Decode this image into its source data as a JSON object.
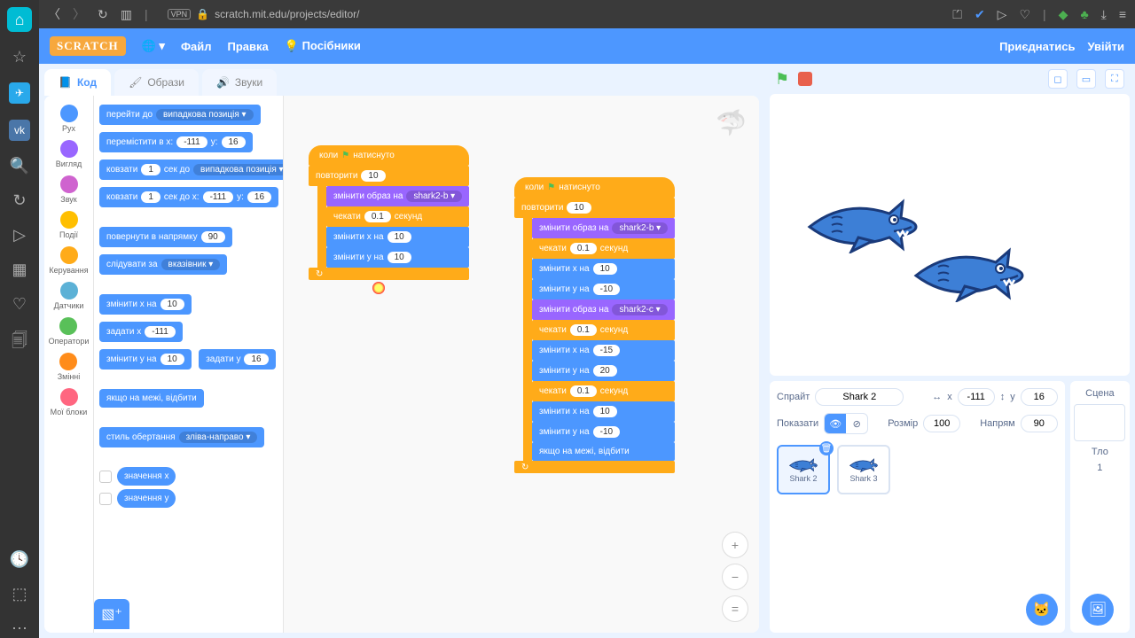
{
  "browser": {
    "url": "scratch.mit.edu/projects/editor/",
    "vpn_badge": "VPN"
  },
  "menu": {
    "file": "Файл",
    "edit": "Правка",
    "tutorials": "Посібники",
    "join": "Приєднатись",
    "signin": "Увійти"
  },
  "tabs": {
    "code": "Код",
    "costumes": "Образи",
    "sounds": "Звуки"
  },
  "categories": {
    "motion": "Рух",
    "looks": "Вигляд",
    "sound": "Звук",
    "events": "Події",
    "control": "Керування",
    "sensing": "Датчики",
    "operators": "Оператори",
    "variables": "Змінні",
    "myblocks": "Мої блоки"
  },
  "cat_colors": {
    "motion": "#4c97ff",
    "looks": "#9966ff",
    "sound": "#cf63cf",
    "events": "#ffbf00",
    "control": "#ffab19",
    "sensing": "#5cb1d6",
    "operators": "#59c059",
    "variables": "#ff8c1a",
    "myblocks": "#ff6680"
  },
  "palette": {
    "goto_label": "перейти до",
    "goto_opt": "випадкова позиція ▾",
    "moveto_xy": "перемістити в x:",
    "moveto_x": "-111",
    "moveto_yl": "y:",
    "moveto_y": "16",
    "glide_rand": "ковзати",
    "glide_rand_sec": "1",
    "glide_rand_to": "сек до",
    "glide_rand_opt": "випадкова позиція ▾",
    "glide_xy": "ковзати",
    "glide_xy_sec": "1",
    "glide_xy_to": "сек до x:",
    "glide_xy_x": "-111",
    "glide_xy_yl": "y:",
    "glide_xy_y": "16",
    "point_dir": "повернути в напрямку",
    "point_dir_v": "90",
    "point_towards": "слідувати за",
    "point_towards_opt": "вказівник ▾",
    "change_x": "змінити x на",
    "change_x_v": "10",
    "set_x": "задати x",
    "set_x_v": "-111",
    "change_y": "змінити y на",
    "change_y_v": "10",
    "set_y": "задати y",
    "set_y_v": "16",
    "bounce": "якщо на межі, відбити",
    "rot_style": "стиль обертання",
    "rot_style_opt": "зліва-направо ▾",
    "xpos": "значення x",
    "ypos": "значення y"
  },
  "script1": {
    "hat": "коли",
    "flag": "⚑",
    "hat2": "натиснуто",
    "repeat": "повторити",
    "repeat_n": "10",
    "switch": "змінити образ на",
    "switch_opt": "shark2-b ▾",
    "wait": "чекати",
    "wait_n": "0.1",
    "wait_u": "секунд",
    "cx": "змінити x на",
    "cx_n": "10",
    "cy": "змінити y на",
    "cy_n": "10"
  },
  "script2": {
    "hat": "коли",
    "flag": "⚑",
    "hat2": "натиснуто",
    "repeat": "повторити",
    "repeat_n": "10",
    "switch1": "змінити образ на",
    "switch1_opt": "shark2-b ▾",
    "wait1": "чекати",
    "wait1_n": "0.1",
    "wait1_u": "секунд",
    "cx1": "змінити x на",
    "cx1_n": "10",
    "cy1": "змінити y на",
    "cy1_n": "-10",
    "switch2": "змінити образ на",
    "switch2_opt": "shark2-c ▾",
    "wait2": "чекати",
    "wait2_n": "0.1",
    "wait2_u": "секунд",
    "cx2": "змінити x на",
    "cx2_n": "-15",
    "cy2": "змінити y на",
    "cy2_n": "20",
    "wait3": "чекати",
    "wait3_n": "0.1",
    "wait3_u": "секунд",
    "cx3": "змінити x на",
    "cx3_n": "10",
    "cy3": "змінити y на",
    "cy3_n": "-10",
    "bounce": "якщо на межі, відбити"
  },
  "sprite_info": {
    "label": "Спрайт",
    "name": "Shark 2",
    "xl": "x",
    "x": "-111",
    "yl": "y",
    "y": "16",
    "show": "Показати",
    "size_l": "Розмір",
    "size": "100",
    "dir_l": "Напрям",
    "dir": "90"
  },
  "sprites": {
    "s1": "Shark 2",
    "s2": "Shark 3"
  },
  "stage_panel": {
    "label": "Сцена",
    "backdrops_l": "Тло",
    "backdrops_n": "1"
  }
}
